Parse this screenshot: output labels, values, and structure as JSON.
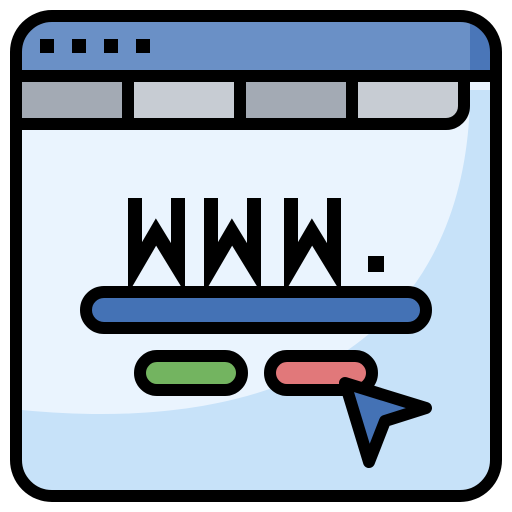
{
  "icon": {
    "name": "web-browser-www-icon",
    "address_text": "WWW.",
    "window_dots": 4,
    "tabs": [
      "tab",
      "tab",
      "tab",
      "tab"
    ],
    "search_bar": "url-input",
    "buttons": [
      "go-button",
      "cancel-button"
    ],
    "cursor": "pointer-cursor-icon"
  },
  "colors": {
    "outline": "#000000",
    "titlebar": "#6a90c6",
    "titlebar_shadow": "#4a76b8",
    "tab_dark": "#a3aab4",
    "tab_light": "#c7ccd3",
    "body_light": "#eaf4fe",
    "body_shadow": "#c7e2f9",
    "search_bar": "#4472b5",
    "button_green": "#73b460",
    "button_red": "#e1787a",
    "cursor": "#4472b5"
  }
}
